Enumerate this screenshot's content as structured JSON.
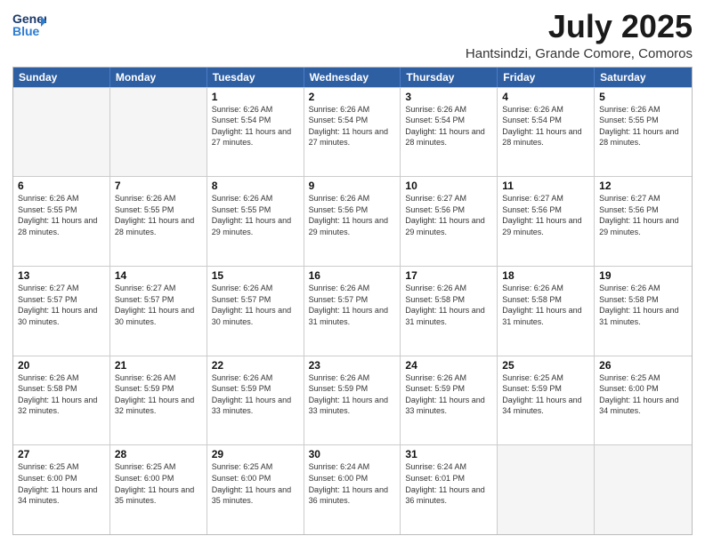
{
  "header": {
    "logo_general": "General",
    "logo_blue": "Blue",
    "main_title": "July 2025",
    "subtitle": "Hantsindzi, Grande Comore, Comoros"
  },
  "days_of_week": [
    "Sunday",
    "Monday",
    "Tuesday",
    "Wednesday",
    "Thursday",
    "Friday",
    "Saturday"
  ],
  "weeks": [
    [
      {
        "day": "",
        "empty": true,
        "sunrise": "",
        "sunset": "",
        "daylight": ""
      },
      {
        "day": "",
        "empty": true,
        "sunrise": "",
        "sunset": "",
        "daylight": ""
      },
      {
        "day": "1",
        "empty": false,
        "sunrise": "Sunrise: 6:26 AM",
        "sunset": "Sunset: 5:54 PM",
        "daylight": "Daylight: 11 hours and 27 minutes."
      },
      {
        "day": "2",
        "empty": false,
        "sunrise": "Sunrise: 6:26 AM",
        "sunset": "Sunset: 5:54 PM",
        "daylight": "Daylight: 11 hours and 27 minutes."
      },
      {
        "day": "3",
        "empty": false,
        "sunrise": "Sunrise: 6:26 AM",
        "sunset": "Sunset: 5:54 PM",
        "daylight": "Daylight: 11 hours and 28 minutes."
      },
      {
        "day": "4",
        "empty": false,
        "sunrise": "Sunrise: 6:26 AM",
        "sunset": "Sunset: 5:54 PM",
        "daylight": "Daylight: 11 hours and 28 minutes."
      },
      {
        "day": "5",
        "empty": false,
        "sunrise": "Sunrise: 6:26 AM",
        "sunset": "Sunset: 5:55 PM",
        "daylight": "Daylight: 11 hours and 28 minutes."
      }
    ],
    [
      {
        "day": "6",
        "empty": false,
        "sunrise": "Sunrise: 6:26 AM",
        "sunset": "Sunset: 5:55 PM",
        "daylight": "Daylight: 11 hours and 28 minutes."
      },
      {
        "day": "7",
        "empty": false,
        "sunrise": "Sunrise: 6:26 AM",
        "sunset": "Sunset: 5:55 PM",
        "daylight": "Daylight: 11 hours and 28 minutes."
      },
      {
        "day": "8",
        "empty": false,
        "sunrise": "Sunrise: 6:26 AM",
        "sunset": "Sunset: 5:55 PM",
        "daylight": "Daylight: 11 hours and 29 minutes."
      },
      {
        "day": "9",
        "empty": false,
        "sunrise": "Sunrise: 6:26 AM",
        "sunset": "Sunset: 5:56 PM",
        "daylight": "Daylight: 11 hours and 29 minutes."
      },
      {
        "day": "10",
        "empty": false,
        "sunrise": "Sunrise: 6:27 AM",
        "sunset": "Sunset: 5:56 PM",
        "daylight": "Daylight: 11 hours and 29 minutes."
      },
      {
        "day": "11",
        "empty": false,
        "sunrise": "Sunrise: 6:27 AM",
        "sunset": "Sunset: 5:56 PM",
        "daylight": "Daylight: 11 hours and 29 minutes."
      },
      {
        "day": "12",
        "empty": false,
        "sunrise": "Sunrise: 6:27 AM",
        "sunset": "Sunset: 5:56 PM",
        "daylight": "Daylight: 11 hours and 29 minutes."
      }
    ],
    [
      {
        "day": "13",
        "empty": false,
        "sunrise": "Sunrise: 6:27 AM",
        "sunset": "Sunset: 5:57 PM",
        "daylight": "Daylight: 11 hours and 30 minutes."
      },
      {
        "day": "14",
        "empty": false,
        "sunrise": "Sunrise: 6:27 AM",
        "sunset": "Sunset: 5:57 PM",
        "daylight": "Daylight: 11 hours and 30 minutes."
      },
      {
        "day": "15",
        "empty": false,
        "sunrise": "Sunrise: 6:26 AM",
        "sunset": "Sunset: 5:57 PM",
        "daylight": "Daylight: 11 hours and 30 minutes."
      },
      {
        "day": "16",
        "empty": false,
        "sunrise": "Sunrise: 6:26 AM",
        "sunset": "Sunset: 5:57 PM",
        "daylight": "Daylight: 11 hours and 31 minutes."
      },
      {
        "day": "17",
        "empty": false,
        "sunrise": "Sunrise: 6:26 AM",
        "sunset": "Sunset: 5:58 PM",
        "daylight": "Daylight: 11 hours and 31 minutes."
      },
      {
        "day": "18",
        "empty": false,
        "sunrise": "Sunrise: 6:26 AM",
        "sunset": "Sunset: 5:58 PM",
        "daylight": "Daylight: 11 hours and 31 minutes."
      },
      {
        "day": "19",
        "empty": false,
        "sunrise": "Sunrise: 6:26 AM",
        "sunset": "Sunset: 5:58 PM",
        "daylight": "Daylight: 11 hours and 31 minutes."
      }
    ],
    [
      {
        "day": "20",
        "empty": false,
        "sunrise": "Sunrise: 6:26 AM",
        "sunset": "Sunset: 5:58 PM",
        "daylight": "Daylight: 11 hours and 32 minutes."
      },
      {
        "day": "21",
        "empty": false,
        "sunrise": "Sunrise: 6:26 AM",
        "sunset": "Sunset: 5:59 PM",
        "daylight": "Daylight: 11 hours and 32 minutes."
      },
      {
        "day": "22",
        "empty": false,
        "sunrise": "Sunrise: 6:26 AM",
        "sunset": "Sunset: 5:59 PM",
        "daylight": "Daylight: 11 hours and 33 minutes."
      },
      {
        "day": "23",
        "empty": false,
        "sunrise": "Sunrise: 6:26 AM",
        "sunset": "Sunset: 5:59 PM",
        "daylight": "Daylight: 11 hours and 33 minutes."
      },
      {
        "day": "24",
        "empty": false,
        "sunrise": "Sunrise: 6:26 AM",
        "sunset": "Sunset: 5:59 PM",
        "daylight": "Daylight: 11 hours and 33 minutes."
      },
      {
        "day": "25",
        "empty": false,
        "sunrise": "Sunrise: 6:25 AM",
        "sunset": "Sunset: 5:59 PM",
        "daylight": "Daylight: 11 hours and 34 minutes."
      },
      {
        "day": "26",
        "empty": false,
        "sunrise": "Sunrise: 6:25 AM",
        "sunset": "Sunset: 6:00 PM",
        "daylight": "Daylight: 11 hours and 34 minutes."
      }
    ],
    [
      {
        "day": "27",
        "empty": false,
        "sunrise": "Sunrise: 6:25 AM",
        "sunset": "Sunset: 6:00 PM",
        "daylight": "Daylight: 11 hours and 34 minutes."
      },
      {
        "day": "28",
        "empty": false,
        "sunrise": "Sunrise: 6:25 AM",
        "sunset": "Sunset: 6:00 PM",
        "daylight": "Daylight: 11 hours and 35 minutes."
      },
      {
        "day": "29",
        "empty": false,
        "sunrise": "Sunrise: 6:25 AM",
        "sunset": "Sunset: 6:00 PM",
        "daylight": "Daylight: 11 hours and 35 minutes."
      },
      {
        "day": "30",
        "empty": false,
        "sunrise": "Sunrise: 6:24 AM",
        "sunset": "Sunset: 6:00 PM",
        "daylight": "Daylight: 11 hours and 36 minutes."
      },
      {
        "day": "31",
        "empty": false,
        "sunrise": "Sunrise: 6:24 AM",
        "sunset": "Sunset: 6:01 PM",
        "daylight": "Daylight: 11 hours and 36 minutes."
      },
      {
        "day": "",
        "empty": true,
        "sunrise": "",
        "sunset": "",
        "daylight": ""
      },
      {
        "day": "",
        "empty": true,
        "sunrise": "",
        "sunset": "",
        "daylight": ""
      }
    ]
  ]
}
